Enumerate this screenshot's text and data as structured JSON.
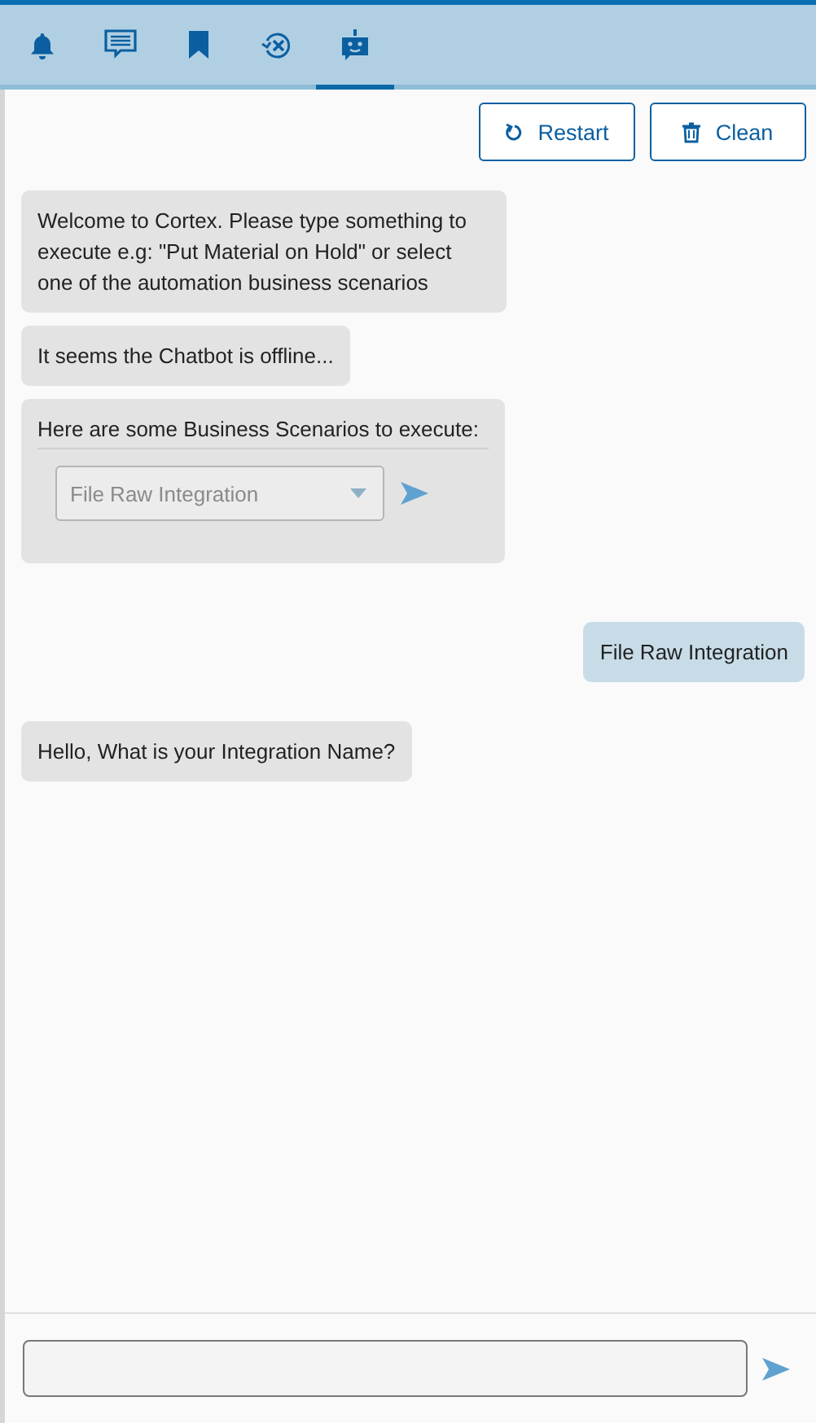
{
  "tabs": [
    {
      "kind": "bell",
      "selected": false
    },
    {
      "kind": "message",
      "selected": false
    },
    {
      "kind": "bookmark",
      "selected": false
    },
    {
      "kind": "cancel-history",
      "selected": false
    },
    {
      "kind": "robot",
      "selected": true
    }
  ],
  "actions": [
    {
      "kind": "restart",
      "label": "Restart"
    },
    {
      "kind": "clean",
      "label": "Clean"
    }
  ],
  "messages": [
    {
      "outgoing": false,
      "kind": "text",
      "text": "Welcome to Cortex. Please type something to execute e.g: \"Put Material on Hold\" or select one of the automation business scenarios"
    },
    {
      "outgoing": false,
      "kind": "text",
      "text": "It seems the Chatbot is offline..."
    },
    {
      "outgoing": false,
      "kind": "scenarios",
      "text": "Here are some Business Scenarios to execute:",
      "dropdown": {
        "value": "File Raw Integration",
        "disabled": true
      }
    },
    {
      "outgoing": true,
      "kind": "text",
      "text": "File Raw Integration"
    },
    {
      "outgoing": false,
      "kind": "text",
      "text": "Hello, What is your Integration Name?"
    }
  ]
}
